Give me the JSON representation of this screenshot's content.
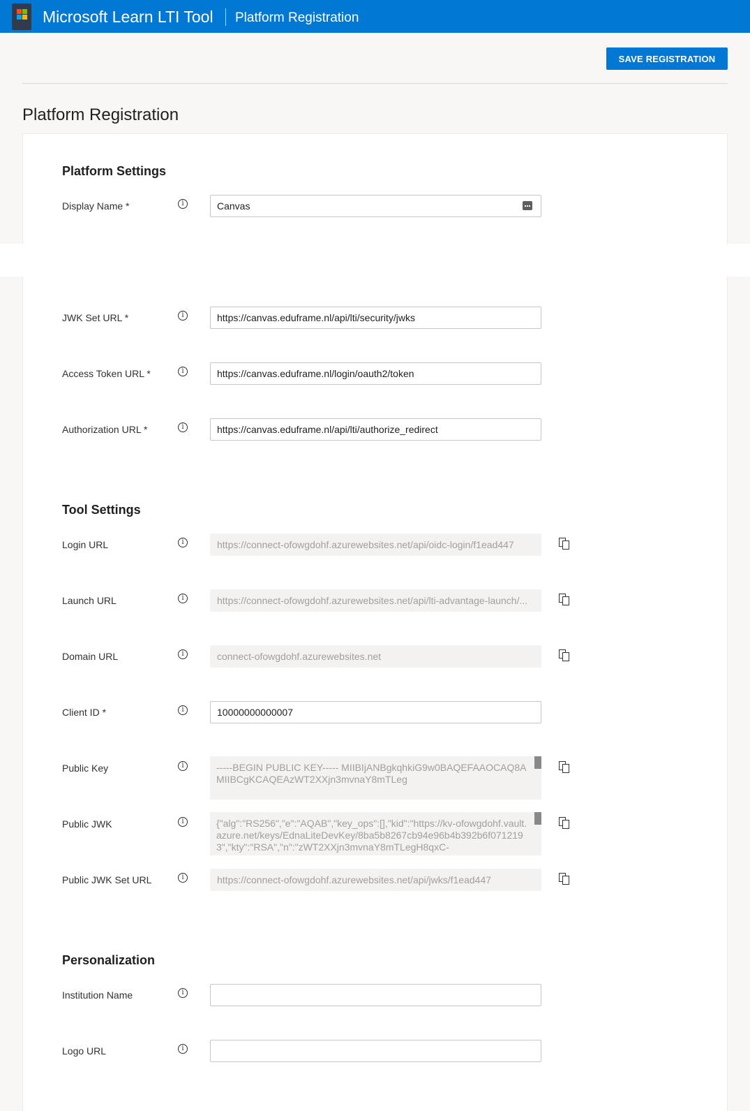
{
  "header": {
    "app_title": "Microsoft Learn LTI Tool",
    "section_title": "Platform Registration"
  },
  "toolbar": {
    "save_label": "SAVE REGISTRATION"
  },
  "page": {
    "title": "Platform Registration"
  },
  "platform_settings": {
    "title": "Platform Settings",
    "display_name": {
      "label": "Display Name *",
      "value": "Canvas"
    },
    "jwk_set_url": {
      "label": "JWK Set URL *",
      "value": "https://canvas.eduframe.nl/api/lti/security/jwks"
    },
    "access_token_url": {
      "label": "Access Token URL *",
      "value": "https://canvas.eduframe.nl/login/oauth2/token"
    },
    "authorization_url": {
      "label": "Authorization URL *",
      "value": "https://canvas.eduframe.nl/api/lti/authorize_redirect"
    }
  },
  "tool_settings": {
    "title": "Tool Settings",
    "login_url": {
      "label": "Login URL",
      "value": "https://connect-ofowgdohf.azurewebsites.net/api/oidc-login/f1ead447"
    },
    "launch_url": {
      "label": "Launch URL",
      "value": "https://connect-ofowgdohf.azurewebsites.net/api/lti-advantage-launch/..."
    },
    "domain_url": {
      "label": "Domain URL",
      "value": "connect-ofowgdohf.azurewebsites.net"
    },
    "client_id": {
      "label": "Client ID *",
      "value": "10000000000007"
    },
    "public_key": {
      "label": "Public Key",
      "value": "-----BEGIN PUBLIC KEY----- MIIBIjANBgkqhkiG9w0BAQEFAAOCAQ8AMIIBCgKCAQEAzWT2XXjn3mvnaY8mTLeg"
    },
    "public_jwk": {
      "label": "Public JWK",
      "value": "{\"alg\":\"RS256\",\"e\":\"AQAB\",\"key_ops\":[],\"kid\":\"https://kv-ofowgdohf.vault.azure.net/keys/EdnaLiteDevKey/8ba5b8267cb94e96b4b392b6f0712193\",\"kty\":\"RSA\",\"n\":\"zWT2XXjn3mvnaY8mTLegH8qxC-"
    },
    "public_jwk_set_url": {
      "label": "Public JWK Set URL",
      "value": "https://connect-ofowgdohf.azurewebsites.net/api/jwks/f1ead447"
    }
  },
  "personalization": {
    "title": "Personalization",
    "institution_name": {
      "label": "Institution Name",
      "value": ""
    },
    "logo_url": {
      "label": "Logo URL",
      "value": ""
    }
  },
  "icons": {
    "info": "info-icon",
    "copy": "copy-icon",
    "field_action": "more-icon",
    "app_logo": "app-logo-icon"
  },
  "colors": {
    "brand": "#0078d4",
    "logo_red": "#f25022",
    "logo_green": "#7fba00",
    "logo_blue": "#00a4ef",
    "logo_yellow": "#ffb900"
  }
}
